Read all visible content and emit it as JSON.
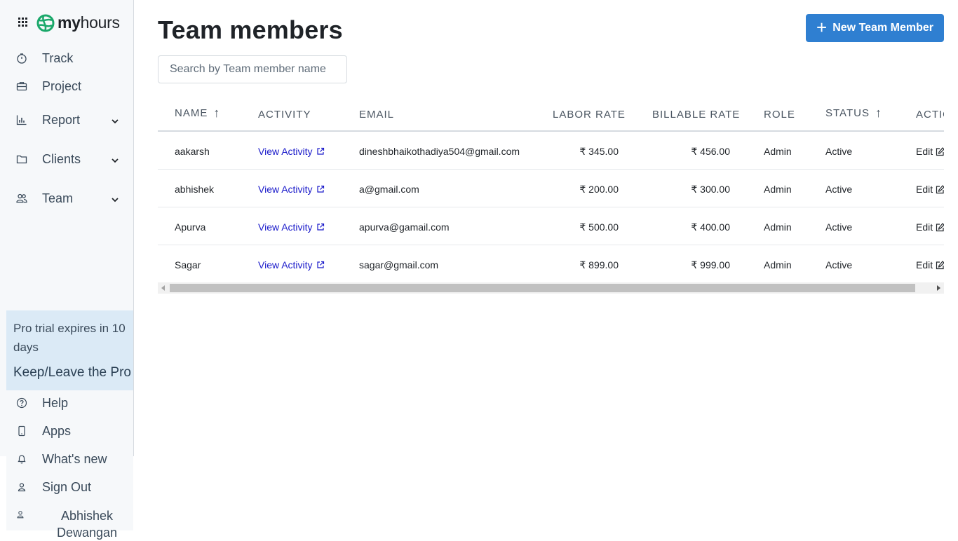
{
  "app": {
    "logo_text_bold": "my",
    "logo_text_rest": "hours"
  },
  "sidebar": {
    "items": [
      {
        "label": "Track",
        "icon": "stopwatch-icon"
      },
      {
        "label": "Project",
        "icon": "briefcase-icon"
      },
      {
        "label": "Report",
        "icon": "bar-chart-icon",
        "expandable": true
      },
      {
        "label": "Clients",
        "icon": "folder-icon",
        "expandable": true
      },
      {
        "label": "Team",
        "icon": "users-icon",
        "expandable": true
      }
    ],
    "trial": {
      "text": "Pro trial expires in 10 days",
      "cta": "Keep/Leave the Pro"
    },
    "bottom_items": [
      {
        "label": "Help",
        "icon": "help-circle-icon"
      },
      {
        "label": "Apps",
        "icon": "smartphone-icon"
      },
      {
        "label": "What's new",
        "icon": "bell-icon"
      },
      {
        "label": "Sign Out",
        "icon": "user-icon"
      }
    ],
    "user": {
      "name": "Abhishek Dewangan",
      "icon": "user-icon"
    }
  },
  "main": {
    "title": "Team members",
    "new_button": "New Team Member",
    "search_placeholder": "Search by Team member name",
    "columns": {
      "name": "NAME",
      "activity": "ACTIVITY",
      "email": "EMAIL",
      "labor_rate": "LABOR RATE",
      "billable_rate": "BILLABLE RATE",
      "role": "ROLE",
      "status": "STATUS",
      "actions": "ACTIONS"
    },
    "sort_arrow": "↑",
    "rows": [
      {
        "name": "aakarsh",
        "activity": "View Activity",
        "email": "dineshbhaikothadiya504@gmail.com",
        "labor_rate": "₹ 345.00",
        "billable_rate": "₹ 456.00",
        "role": "Admin",
        "status": "Active",
        "action": "Edit"
      },
      {
        "name": "abhishek",
        "activity": "View Activity",
        "email": "a@gmail.com",
        "labor_rate": "₹ 200.00",
        "billable_rate": "₹ 300.00",
        "role": "Admin",
        "status": "Active",
        "action": "Edit"
      },
      {
        "name": "Apurva",
        "activity": "View Activity",
        "email": "apurva@gamail.com",
        "labor_rate": "₹ 500.00",
        "billable_rate": "₹ 400.00",
        "role": "Admin",
        "status": "Active",
        "action": "Edit"
      },
      {
        "name": "Sagar",
        "activity": "View Activity",
        "email": "sagar@gmail.com",
        "labor_rate": "₹ 899.00",
        "billable_rate": "₹ 999.00",
        "role": "Admin",
        "status": "Active",
        "action": "Edit"
      }
    ]
  },
  "colors": {
    "accent": "#2f7fd1",
    "link": "#1a1aca",
    "trial_bg": "#dbeaf6",
    "sidebar_bg": "#f6f8fa",
    "logo_green": "#1aa86a"
  }
}
